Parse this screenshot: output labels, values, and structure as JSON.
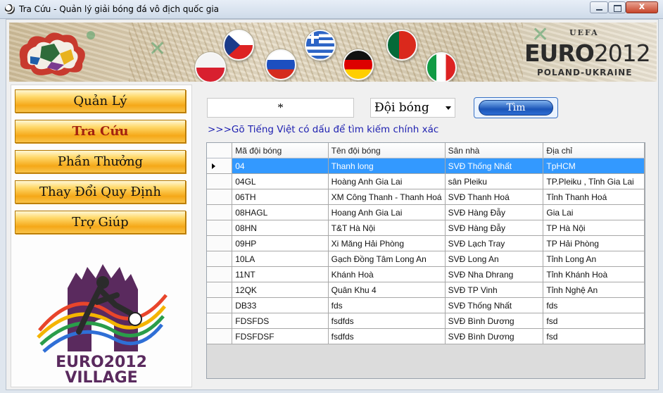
{
  "window": {
    "title": "Tra Cứu - Quản lý giải bóng đá vô địch quốc gia",
    "close_glyph": "x"
  },
  "banner": {
    "uefa": "UEFA",
    "euro": "EURO",
    "year": "2012",
    "subtitle": "POLAND-UKRAINE"
  },
  "menu": {
    "items": [
      {
        "label": "Quản Lý"
      },
      {
        "label": "Tra Cứu",
        "active": true
      },
      {
        "label": "Phần Thưởng"
      },
      {
        "label": "Thay Đổi Quy Định"
      },
      {
        "label": "Trợ Giúp"
      }
    ]
  },
  "village_logo": {
    "line1": "EURO2012",
    "line2": "VILLAGE"
  },
  "search": {
    "value": "*",
    "field_selected": "Đội bóng",
    "button_label": "Tìm",
    "hint": ">>>Gõ Tiếng Việt có dấu để tìm kiếm chính xác"
  },
  "table": {
    "columns": [
      "Mã đội bóng",
      "Tên đội bóng",
      "Sân nhà",
      "Địa chỉ"
    ],
    "selected_row": 0,
    "rows": [
      [
        "04",
        "Thanh long",
        "SVĐ Thống Nhất",
        "TpHCM"
      ],
      [
        "04GL",
        "Hoàng Anh Gia Lai",
        "sân Pleiku",
        "TP.Pleiku , Tỉnh Gia Lai"
      ],
      [
        "06TH",
        "XM Công Thanh - Thanh Hoá",
        "SVĐ Thanh Hoá",
        "Tỉnh Thanh Hoá"
      ],
      [
        "08HAGL",
        "Hoang Anh Gia Lai",
        "SVĐ Hàng Đẫy",
        "Gia Lai"
      ],
      [
        "08HN",
        "T&T Hà Nội",
        "SVĐ Hàng Đẫy",
        "TP Hà Nội"
      ],
      [
        "09HP",
        "Xi Măng Hải Phòng",
        "SVĐ Lạch Tray",
        "TP Hải Phòng"
      ],
      [
        "10LA",
        "Gạch Đồng Tâm Long An",
        "SVĐ Long An",
        "Tỉnh Long An"
      ],
      [
        "11NT",
        "Khánh Hoà",
        "SVĐ Nha Dhrang",
        "Tỉnh Khánh Hoà"
      ],
      [
        "12QK",
        "Quân Khu 4",
        "SVĐ TP Vinh",
        "Tỉnh Nghệ An"
      ],
      [
        "DB33",
        "fds",
        "SVĐ Thống Nhất",
        "fds"
      ],
      [
        "FDSFDS",
        "fsdfds",
        "SVĐ Bình Dương",
        "fsd"
      ],
      [
        "FDSFDSF",
        "fsdfds",
        "SVĐ Bình Dương",
        "fsd"
      ]
    ]
  },
  "colors": {
    "selection": "#3399ff",
    "hint_text": "#1d1fb0",
    "active_menu_text": "#a3210f",
    "menu_orange": "#f5a818"
  }
}
